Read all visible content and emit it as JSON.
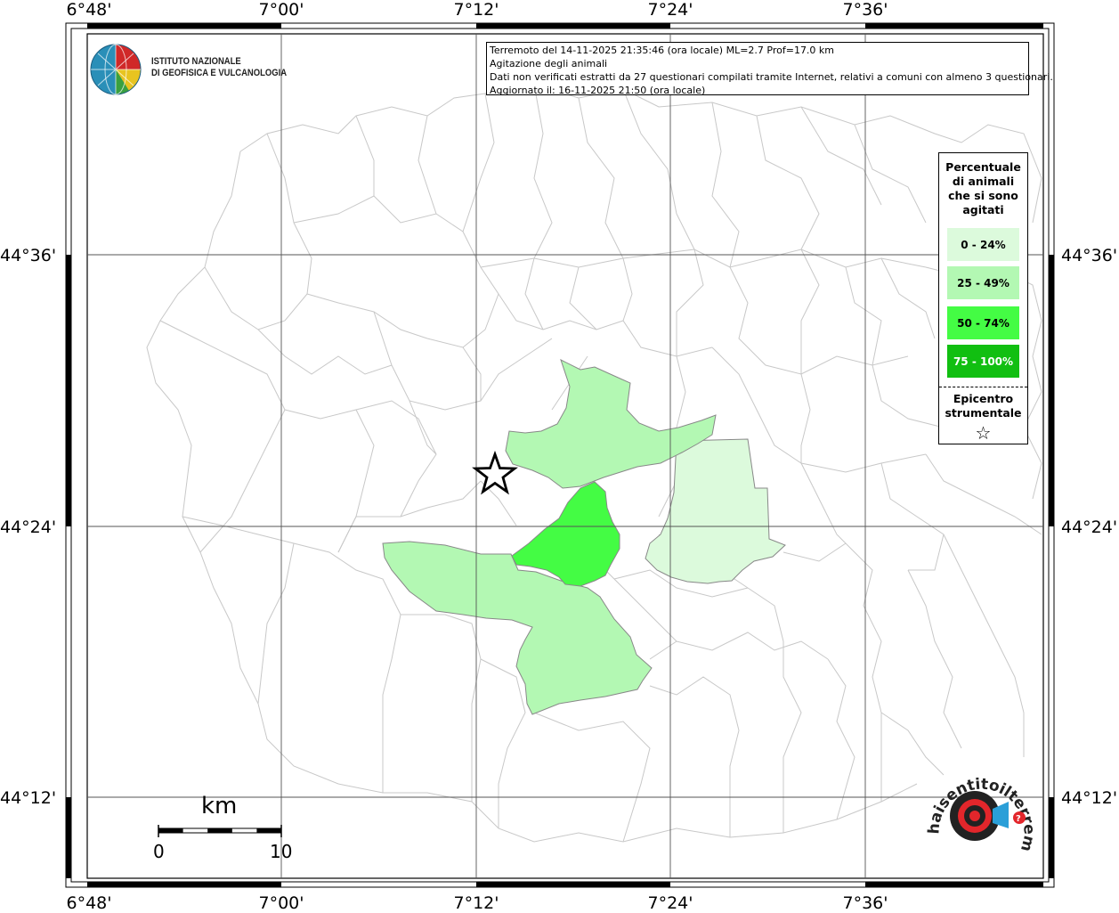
{
  "map": {
    "top_lon_labels": [
      "6°48'",
      "7°00'",
      "7°12'",
      "7°24'",
      "7°36'"
    ],
    "bottom_lon_labels": [
      "6°48'",
      "7°00'",
      "7°12'",
      "7°24'",
      "7°36'"
    ],
    "left_lat_labels": [
      "44°36'",
      "44°24'",
      "44°12'"
    ],
    "right_lat_labels": [
      "44°36'",
      "44°24'",
      "44°12'"
    ]
  },
  "info": {
    "line1": "Terremoto del 14-11-2025 21:35:46 (ora locale) ML=2.7 Prof=17.0 km",
    "line2": "Agitazione degli animali",
    "line3": "Dati non verificati estratti da 27 questionari compilati tramite Internet, relativi a comuni con almeno 3 questionari.",
    "line4": "Aggiornato il: 16-11-2025 21:50 (ora locale)"
  },
  "logo": {
    "line1": "ISTITUTO NAZIONALE",
    "line2": "DI GEOFISICA E VULCANOLOGIA"
  },
  "legend": {
    "title_lines": [
      "Percentuale",
      "di animali",
      "che si sono",
      "agitati"
    ],
    "classes": [
      {
        "label": "0 - 24%",
        "color": "#dcfadc",
        "text_color": "#000000"
      },
      {
        "label": "25 - 49%",
        "color": "#b3f8b3",
        "text_color": "#000000"
      },
      {
        "label": "50 - 74%",
        "color": "#44fc44",
        "text_color": "#000000"
      },
      {
        "label": "75 - 100%",
        "color": "#11bf11",
        "text_color": "#ffffff"
      }
    ],
    "epicentro_lines": [
      "Epicentro",
      "strumentale"
    ],
    "star_symbol": "☆"
  },
  "scale": {
    "unit": "km",
    "start": "0",
    "end": "10"
  },
  "watermark": {
    "text": "haisentitoilterremoto.it"
  }
}
